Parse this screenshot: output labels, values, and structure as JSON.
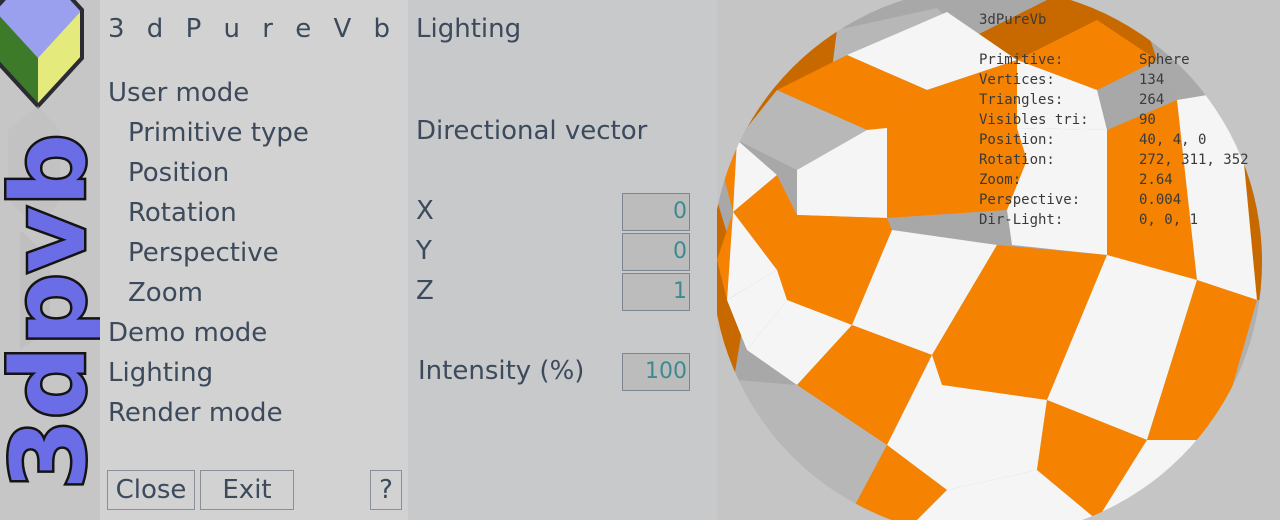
{
  "app": {
    "title": "3 d P u r e V b",
    "logo_text": "3dpvb",
    "logo_icon": "isometric-cube-icon"
  },
  "menu": {
    "items": [
      {
        "label": "User mode",
        "level": 0
      },
      {
        "label": "Primitive type",
        "level": 1
      },
      {
        "label": "Position",
        "level": 1
      },
      {
        "label": "Rotation",
        "level": 1
      },
      {
        "label": "Perspective",
        "level": 1
      },
      {
        "label": "Zoom",
        "level": 1
      },
      {
        "label": "Demo mode",
        "level": 0
      },
      {
        "label": "Lighting",
        "level": 0
      },
      {
        "label": "Render mode",
        "level": 0
      }
    ],
    "close_label": "Close",
    "exit_label": "Exit",
    "help_label": "?"
  },
  "settings": {
    "heading": "Lighting",
    "section_label": "Directional vector",
    "x_label": "X",
    "x_value": "0",
    "y_label": "Y",
    "y_value": "0",
    "z_label": "Z",
    "z_value": "1",
    "intensity_label": "Intensity (%)",
    "intensity_value": "100"
  },
  "viewport": {
    "title": "3dPureVb",
    "stats": [
      {
        "label": "Primitive:",
        "value": "Sphere"
      },
      {
        "label": "Vertices:",
        "value": "134"
      },
      {
        "label": "Triangles:",
        "value": "264"
      },
      {
        "label": "Visibles tri:",
        "value": "90"
      },
      {
        "label": "Position:",
        "value": "40, 4, 0"
      },
      {
        "label": "Rotation:",
        "value": "272, 311, 352"
      },
      {
        "label": "Zoom:",
        "value": "2.64"
      },
      {
        "label": "Perspective:",
        "value": "0.004"
      },
      {
        "label": "Dir-Light:",
        "value": "0, 0, 1"
      }
    ]
  },
  "colors": {
    "accent_orange": "#f58200",
    "panel_text": "#3c4a5c",
    "field_text": "#3e8a92",
    "logo_purple": "#6b6de6"
  }
}
